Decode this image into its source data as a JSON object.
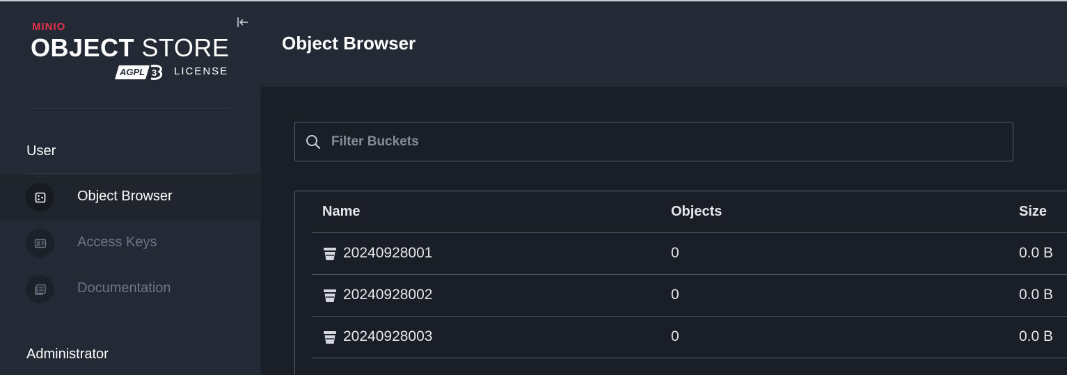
{
  "sidebar": {
    "logo": {
      "brand": "MINIO",
      "product_bold": "OBJECT",
      "product_light": "STORE",
      "license_badge": "AGPLv3",
      "license": "LICENSE"
    },
    "sections": {
      "user": "User",
      "administrator": "Administrator"
    },
    "items": [
      {
        "label": "Object Browser",
        "icon": "object-browser-icon",
        "active": true
      },
      {
        "label": "Access Keys",
        "icon": "access-keys-icon",
        "active": false
      },
      {
        "label": "Documentation",
        "icon": "documentation-icon",
        "active": false
      }
    ]
  },
  "header": {
    "title": "Object Browser"
  },
  "search": {
    "placeholder": "Filter Buckets",
    "value": ""
  },
  "table": {
    "columns": {
      "name": "Name",
      "objects": "Objects",
      "size": "Size"
    },
    "rows": [
      {
        "name": "20240928001",
        "objects": "0",
        "size": "0.0 B"
      },
      {
        "name": "20240928002",
        "objects": "0",
        "size": "0.0 B"
      },
      {
        "name": "20240928003",
        "objects": "0",
        "size": "0.0 B"
      }
    ]
  },
  "colors": {
    "brand_red": "#e6324b",
    "sidebar_bg": "#242a35",
    "main_bg": "#1a1e27"
  }
}
